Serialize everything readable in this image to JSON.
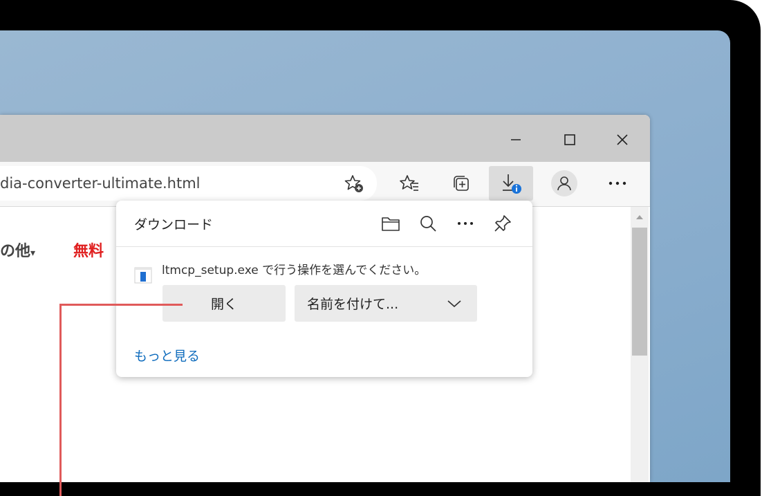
{
  "browser": {
    "window_controls": {
      "minimize": "minimize-icon",
      "maximize": "maximize-icon",
      "close": "close-icon"
    },
    "address_text": "dia-converter-ultimate.html",
    "page_nav": {
      "item_other": "の他",
      "item_free": "無料"
    }
  },
  "download_panel": {
    "title": "ダウンロード",
    "message": "ltmcp_setup.exe で行う操作を選んでください。",
    "open_label": "開く",
    "save_as_label": "名前を付けて...",
    "see_more": "もっと見る"
  },
  "colors": {
    "accent_link": "#0f6cbd",
    "annotation_line": "#e05a5a",
    "badge": "#1a73d9"
  }
}
